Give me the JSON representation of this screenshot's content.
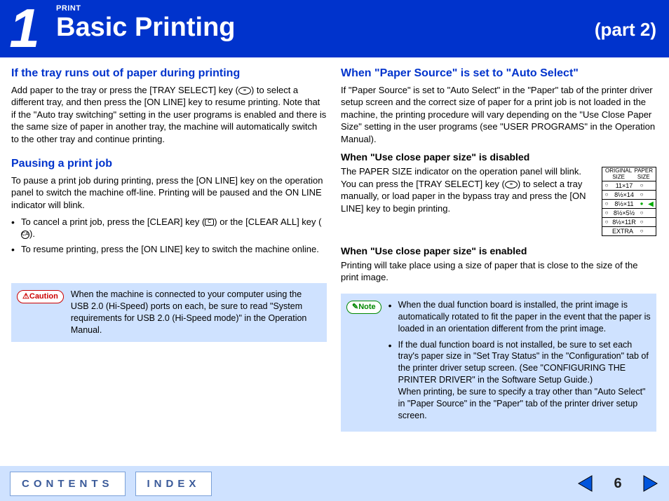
{
  "header": {
    "chapter_number": "1",
    "section_label": "PRINT",
    "title": "Basic Printing",
    "part": "(part 2)"
  },
  "left": {
    "h1": "If the tray runs out of paper during printing",
    "p1a": "Add paper to the tray or press the [TRAY SELECT] key (",
    "p1b": ") to select a different tray, and then press the [ON LINE] key to resume printing. Note that if the \"Auto tray switching\" setting in the user programs is enabled and there is the same size of paper in another tray, the machine will automatically switch to the other tray and continue printing.",
    "h2": "Pausing a print job",
    "p2": "To pause a print job during printing, press the [ON LINE] key on the operation panel to switch the machine off-line. Printing will be paused and the ON LINE indicator will blink.",
    "b1a": "To cancel a print job, press the [CLEAR] key (",
    "b1b": ") or the [CLEAR ALL] key (",
    "b1c": ").",
    "b2": "To resume printing, press the [ON LINE] key to switch the machine online.",
    "caution_label": "Caution",
    "caution_text": "When the machine is connected to your computer using the USB 2.0 (Hi-Speed) ports on each, be sure to read \"System requirements for USB 2.0 (Hi-Speed mode)\" in the Operation Manual."
  },
  "right": {
    "h1": "When \"Paper Source\" is set to \"Auto Select\"",
    "p1": "If \"Paper Source\" is set to \"Auto Select\" in the \"Paper\" tab of the printer driver setup screen and the correct size of paper for a print job is not loaded in the machine, the printing procedure will vary depending on the \"Use Close Paper Size\" setting in the user programs (see \"USER PROGRAMS\" in the Operation Manual).",
    "h2": "When \"Use close paper size\" is disabled",
    "p2a": "The PAPER SIZE indicator on the operation panel will blink. You can press the [TRAY SELECT] key (",
    "p2b": ") to select a tray manually, or load paper in the bypass tray and press the [ON LINE] key to begin printing.",
    "h3": "When \"Use close paper size\" is enabled",
    "p3": "Printing will take place using a size of paper that is close to the size of the print image.",
    "note_label": "Note",
    "note_b1": "When the dual function board is installed, the print image is automatically rotated to fit the paper in the event that the paper is loaded in an orientation different from the print image.",
    "note_b2": "If the dual function board is not installed, be sure to set each tray's paper size in \"Set Tray Status\" in the \"Configuration\" tab of the printer driver setup screen. (See \"CONFIGURING THE PRINTER DRIVER\" in the Software Setup Guide.)",
    "note_b2_cont": "When printing, be sure to specify a tray other than \"Auto Select\" in \"Paper Source\" in the \"Paper\" tab of the printer driver setup screen.",
    "fig": {
      "head_left": "ORIGINAL\nSIZE",
      "head_right": "PAPER\nSIZE",
      "rows": [
        "11×17",
        "8½×14",
        "8½×11",
        "8½×5½",
        "8½×11R",
        "EXTRA"
      ]
    }
  },
  "footer": {
    "contents": "CONTENTS",
    "index": "INDEX",
    "page": "6"
  }
}
